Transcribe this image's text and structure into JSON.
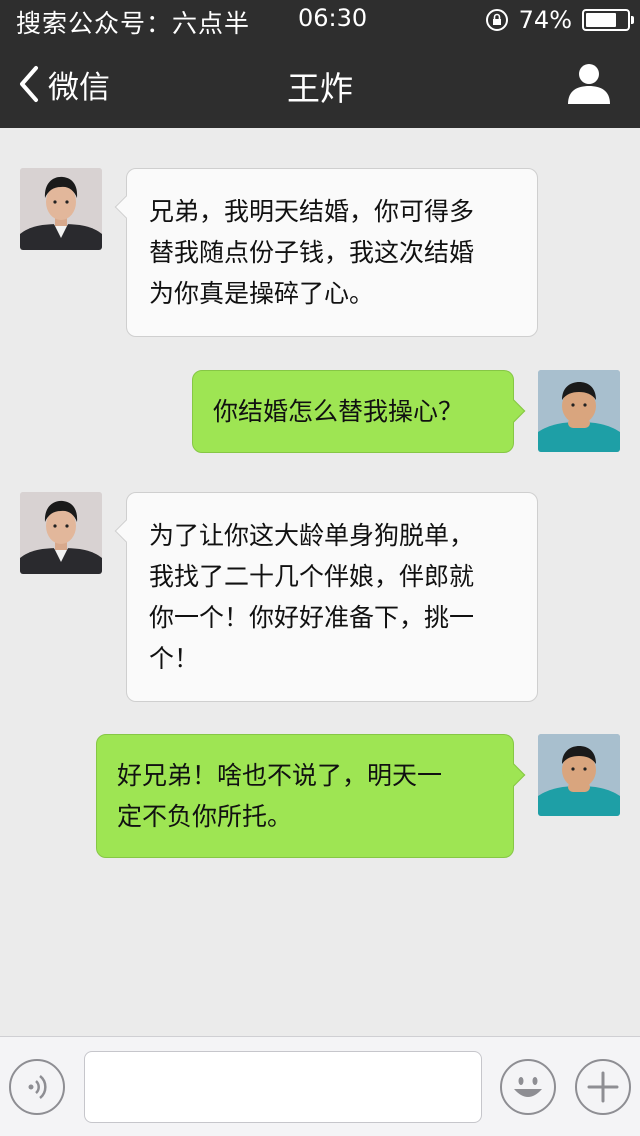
{
  "status_bar": {
    "carrier_text": "搜索公众号：六点半",
    "time": "06:30",
    "battery_percent": "74%",
    "battery_level": 0.74
  },
  "nav": {
    "back_label": "微信",
    "title": "王炸"
  },
  "messages": [
    {
      "sender": "contact",
      "text": "兄弟，我明天结婚，你可得多\n替我随点份子钱，我这次结婚\n为你真是操碎了心。"
    },
    {
      "sender": "me",
      "text": "你结婚怎么替我操心？"
    },
    {
      "sender": "contact",
      "text": "为了让你这大龄单身狗脱单，\n我找了二十几个伴娘，伴郎就\n你一个！你好好准备下，挑一\n个！"
    },
    {
      "sender": "me",
      "text": "好兄弟！啥也不说了，明天一\n定不负你所托。"
    }
  ],
  "input": {
    "value": "",
    "placeholder": ""
  },
  "icons": {
    "back": "chevron-left-icon",
    "profile": "person-icon",
    "voice": "voice-icon",
    "emoji": "emoji-icon",
    "plus": "plus-icon",
    "lock": "rotation-lock-icon",
    "battery": "battery-icon"
  },
  "colors": {
    "header_bg": "#2e2e2e",
    "chat_bg": "#ebebeb",
    "incoming_bubble": "#fafafa",
    "outgoing_bubble": "#9ee553"
  }
}
